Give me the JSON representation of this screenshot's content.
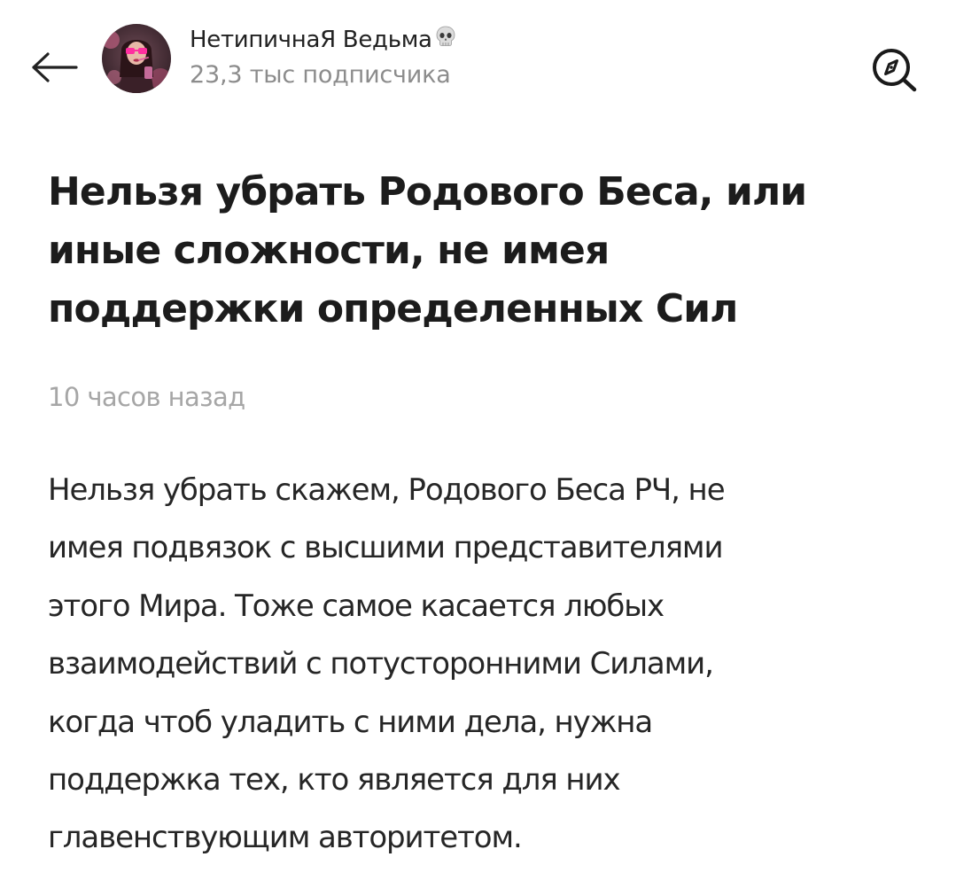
{
  "header": {
    "back_icon": "arrow-left-icon",
    "channel_name": "НетипичнаЯ Ведьма",
    "channel_emoji_icon": "skull-icon",
    "subscribers": "23,3 тыс подписчика",
    "explore_icon": "compass-search-icon"
  },
  "article": {
    "title_lines": [
      "Нельзя убрать Родового Беса, или",
      "иные сложности, не имея",
      "поддержки определенных Сил"
    ],
    "timestamp": "10 часов назад",
    "body_lines": [
      "Нельзя убрать скажем, Родового Беса РЧ, не",
      "имея подвязок с высшими представителями",
      "этого Мира. Тоже самое касается любых",
      "взаимодействий с потусторонними Силами,",
      "когда чтоб уладить с ними дела, нужна",
      "поддержка тех, кто является для них",
      "главенствующим авторитетом."
    ]
  },
  "colors": {
    "text_primary": "#1c1c1c",
    "text_secondary": "#8c8c8c",
    "timestamp": "#a6a6a6",
    "background": "#ffffff"
  }
}
